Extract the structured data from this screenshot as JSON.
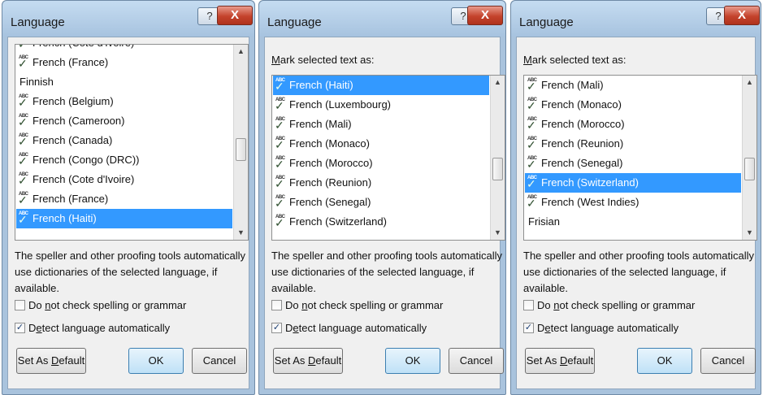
{
  "strings": {
    "title": "Language",
    "help": "?",
    "close": "X",
    "mark_label_prefix": "",
    "mark_label_u": "M",
    "mark_label_rest": "ark selected text as:",
    "description": "The speller and other proofing tools automatically use dictionaries of the selected language, if available.",
    "no_check_pre": "Do ",
    "no_check_u": "n",
    "no_check_post": "ot check spelling or grammar",
    "detect_pre": "D",
    "detect_u": "e",
    "detect_post": "tect language automatically",
    "set_default_pre": "Set As ",
    "set_default_u": "D",
    "set_default_post": "efault",
    "ok": "OK",
    "cancel": "Cancel",
    "abc": "ABC"
  },
  "dialogs": [
    {
      "has_mark_label": false,
      "items": [
        {
          "label": "French (Cote d'Ivoire)",
          "spell": true,
          "selected": false,
          "partial": true
        },
        {
          "label": "French (France)",
          "spell": true,
          "selected": false
        },
        {
          "label": "Finnish",
          "spell": false,
          "selected": false
        },
        {
          "label": "French (Belgium)",
          "spell": true,
          "selected": false
        },
        {
          "label": "French (Cameroon)",
          "spell": true,
          "selected": false
        },
        {
          "label": "French (Canada)",
          "spell": true,
          "selected": false
        },
        {
          "label": "French (Congo (DRC))",
          "spell": true,
          "selected": false
        },
        {
          "label": "French (Cote d'Ivoire)",
          "spell": true,
          "selected": false
        },
        {
          "label": "French (France)",
          "spell": true,
          "selected": false
        },
        {
          "label": "French (Haiti)",
          "spell": true,
          "selected": true
        }
      ],
      "scroll_position": 0.55,
      "no_check_checked": false,
      "detect_checked": true
    },
    {
      "has_mark_label": true,
      "items": [
        {
          "label": "French (Haiti)",
          "spell": true,
          "selected": true
        },
        {
          "label": "French (Luxembourg)",
          "spell": true,
          "selected": false
        },
        {
          "label": "French (Mali)",
          "spell": true,
          "selected": false
        },
        {
          "label": "French (Monaco)",
          "spell": true,
          "selected": false
        },
        {
          "label": "French (Morocco)",
          "spell": true,
          "selected": false
        },
        {
          "label": "French (Reunion)",
          "spell": true,
          "selected": false
        },
        {
          "label": "French (Senegal)",
          "spell": true,
          "selected": false
        },
        {
          "label": "French (Switzerland)",
          "spell": true,
          "selected": false
        }
      ],
      "scroll_position": 0.6,
      "no_check_checked": false,
      "detect_checked": true
    },
    {
      "has_mark_label": true,
      "items": [
        {
          "label": "French (Mali)",
          "spell": true,
          "selected": false
        },
        {
          "label": "French (Monaco)",
          "spell": true,
          "selected": false
        },
        {
          "label": "French (Morocco)",
          "spell": true,
          "selected": false
        },
        {
          "label": "French (Reunion)",
          "spell": true,
          "selected": false
        },
        {
          "label": "French (Senegal)",
          "spell": true,
          "selected": false
        },
        {
          "label": "French (Switzerland)",
          "spell": true,
          "selected": true
        },
        {
          "label": "French (West Indies)",
          "spell": true,
          "selected": false
        },
        {
          "label": "Frisian",
          "spell": false,
          "selected": false
        }
      ],
      "scroll_position": 0.6,
      "no_check_checked": false,
      "detect_checked": true
    }
  ]
}
